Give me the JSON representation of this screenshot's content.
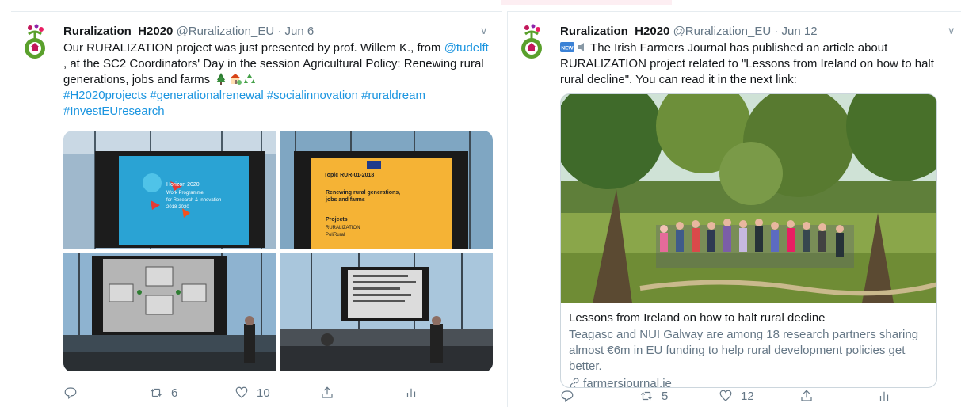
{
  "tweets": [
    {
      "name": "Ruralization_H2020",
      "handle": "@Ruralization_EU",
      "separator": "·",
      "date": "Jun 6",
      "text_start": "Our RURALIZATION project was just presented by prof. Willem K., from ",
      "mention": "@tudelft",
      "text_end": " , at the SC2 Coordinators' Day in the session Agricultural Policy: Renewing rural generations, jobs and farms",
      "emojis": [
        "tree-emoji",
        "house-emoji",
        "recycle-emoji"
      ],
      "hashtags": "#H2020projects #generationalrenewal #socialinnovation #ruraldream #InvestEUresearch",
      "photos": [
        {
          "name": "presentation-slide-horizon2020",
          "slide_text": [
            "Horizon 2020",
            "Work Programme",
            "for Research & Innovation",
            "2018-2020"
          ]
        },
        {
          "name": "presentation-slide-topic",
          "slide_text": [
            "Topic RUR-01-2018",
            "Renewing rural generations,",
            "jobs and farms",
            "Projects",
            "RURALIZATION",
            "PoliRural"
          ]
        },
        {
          "name": "presentation-slide-diagram",
          "slide_text": []
        },
        {
          "name": "conference-room-speaker",
          "slide_text": []
        }
      ],
      "actions": {
        "reply": "",
        "retweet": "6",
        "like": "10",
        "share": "",
        "analytics": ""
      }
    },
    {
      "name": "Ruralization_H2020",
      "handle": "@Ruralization_EU",
      "separator": "·",
      "date": "Jun 12",
      "text": "The Irish Farmers Journal has published an article about RURALIZATION project related to \"Lessons from Ireland on how to halt rural decline\". You can read it in the next link:",
      "new_badge": "NEW",
      "card": {
        "title": "Lessons from Ireland on how to halt rural decline",
        "description": "Teagasc and NUI Galway are among 18 research partners sharing almost €6m in EU funding to help rural development policies get better.",
        "url": "farmersjournal.ie"
      },
      "actions": {
        "reply": "",
        "retweet": "5",
        "like": "12",
        "share": "",
        "analytics": ""
      }
    }
  ],
  "colors": {
    "link": "#1b95e0",
    "text": "#14171a",
    "muted": "#657786",
    "border": "#ccd6dd",
    "brand_green": "#5aa02c",
    "brand_pink": "#c2185b"
  },
  "icons": [
    "ruralization-logo-icon",
    "chevron-down-icon",
    "reply-icon",
    "retweet-icon",
    "like-icon",
    "share-icon",
    "analytics-icon",
    "link-icon",
    "new-badge-icon",
    "speaker-icon"
  ]
}
